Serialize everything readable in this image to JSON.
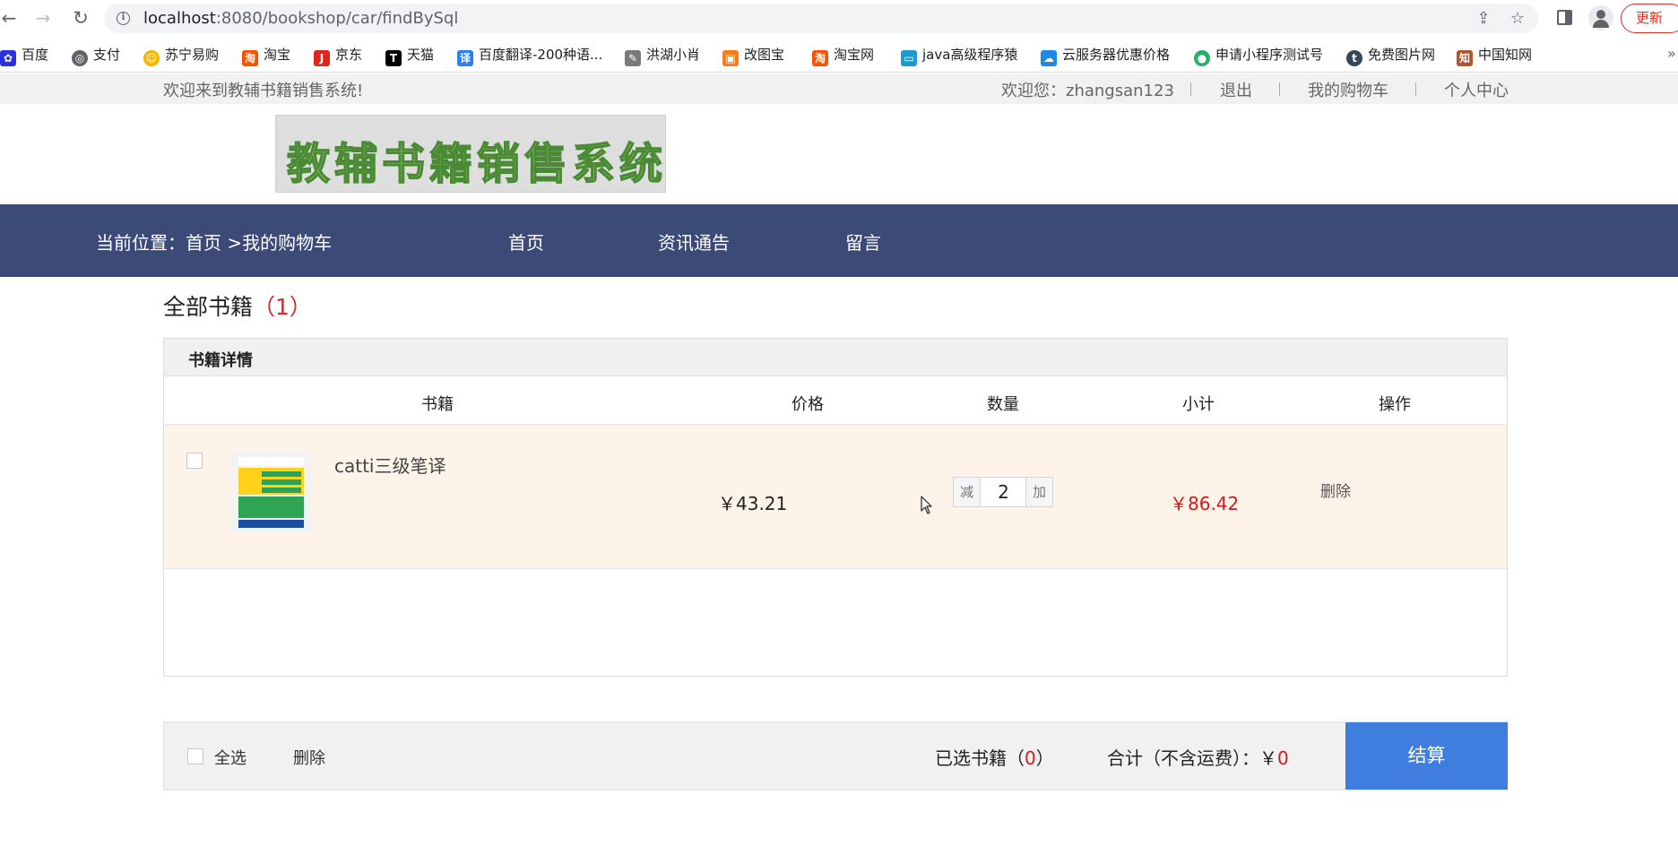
{
  "browser": {
    "url_host": "localhost",
    "url_path": ":8080/bookshop/car/findBySql",
    "update_label": "更新",
    "bookmarks": [
      {
        "label": "百度",
        "icon": "baidu-paw-icon",
        "color": "#2932e1"
      },
      {
        "label": "支付",
        "icon": "globe-icon",
        "color": "#5f6368"
      },
      {
        "label": "苏宁易购",
        "icon": "suning-lion-icon",
        "color": "#f7b500"
      },
      {
        "label": "淘宝",
        "icon": "taobao-icon",
        "color": "#ff5000"
      },
      {
        "label": "京东",
        "icon": "jd-icon",
        "color": "#e1251b"
      },
      {
        "label": "天猫",
        "icon": "tmall-icon",
        "color": "#000000"
      },
      {
        "label": "百度翻译-200种语...",
        "icon": "translate-icon",
        "color": "#2e7cf6"
      },
      {
        "label": "洪湖小肖",
        "icon": "pencil-icon",
        "color": "#7a7a7a"
      },
      {
        "label": "改图宝",
        "icon": "gaitubao-icon",
        "color": "#ff7a1a"
      },
      {
        "label": "淘宝网",
        "icon": "taobao-icon",
        "color": "#ff5000"
      },
      {
        "label": "java高级程序猿",
        "icon": "bilibili-icon",
        "color": "#1d9bd1"
      },
      {
        "label": "云服务器优惠价格",
        "icon": "cloud-icon",
        "color": "#1e88e5"
      },
      {
        "label": "申请小程序测试号",
        "icon": "wechat-icon",
        "color": "#2aae67"
      },
      {
        "label": "免费图片网",
        "icon": "tumblr-icon",
        "color": "#36465d"
      },
      {
        "label": "中国知网",
        "icon": "cnki-icon",
        "color": "#b5532b"
      }
    ]
  },
  "topbar": {
    "welcome": "欢迎来到教辅书籍销售系统!",
    "user_greeting": "欢迎您：zhangsan123",
    "logout": "退出",
    "my_cart": "我的购物车",
    "profile": "个人中心"
  },
  "logo": {
    "text": "教辅书籍销售系统"
  },
  "navbar": {
    "breadcrumb": "当前位置：首页 >我的购物车",
    "links": [
      "首页",
      "资讯通告",
      "留言"
    ]
  },
  "section": {
    "title": "全部书籍",
    "count": "（1）"
  },
  "cart": {
    "panel_title": "书籍详情",
    "columns": [
      "书籍",
      "价格",
      "数量",
      "小计",
      "操作"
    ],
    "items": [
      {
        "name": "catti三级笔译",
        "price": "￥43.21",
        "quantity": "2",
        "minus_label": "减",
        "plus_label": "加",
        "subtotal": "￥86.42",
        "delete_label": "删除",
        "checked": false
      }
    ]
  },
  "footer": {
    "select_all": "全选",
    "delete": "删除",
    "selected_prefix": "已选书籍（",
    "selected_count": "0",
    "selected_suffix": "）",
    "total_prefix": "合计（不含运费）：￥",
    "total_value": "0",
    "checkout": "结算"
  }
}
